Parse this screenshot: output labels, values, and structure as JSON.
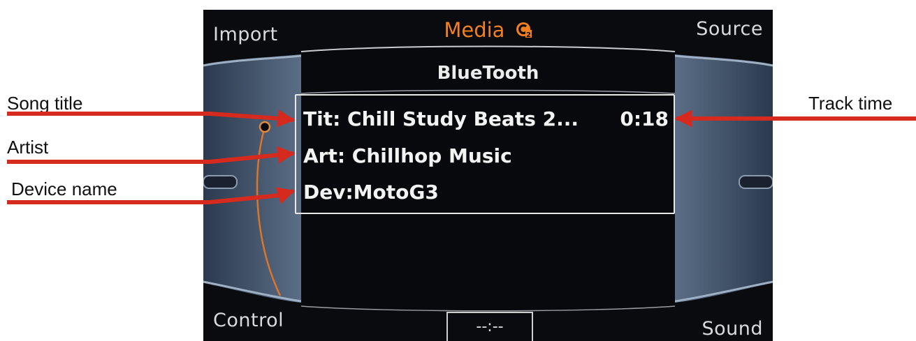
{
  "softkeys": {
    "top_left": "Import",
    "top_right": "Source",
    "bottom_left": "Control",
    "bottom_right": "Sound"
  },
  "header": {
    "title": "Media",
    "badge_icon": "c2-icon",
    "accent_color": "#f2801f"
  },
  "source": "BlueTooth",
  "track": {
    "title_line": "Tit: Chill Study Beats 2...",
    "time": "0:18",
    "artist_line": "Art: Chillhop Music",
    "device_line": "Dev:MotoG3"
  },
  "clock": "--:--",
  "annotations": {
    "song_title": "Song title",
    "artist": "Artist",
    "device_name": "Device name",
    "track_time": "Track time",
    "arrow_color": "#d62a1e"
  }
}
